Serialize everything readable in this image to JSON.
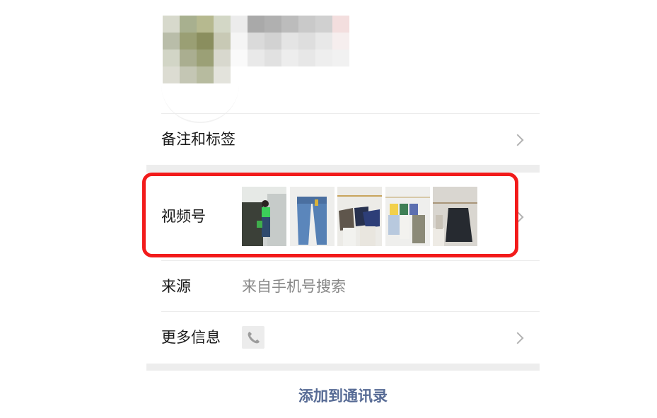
{
  "rows": {
    "remarks_tags": {
      "label": "备注和标签"
    },
    "channels": {
      "label": "视频号"
    },
    "source": {
      "label": "来源",
      "value": "来自手机号搜索"
    },
    "more_info": {
      "label": "更多信息"
    }
  },
  "action": {
    "add_to_contacts": "添加到通讯录"
  },
  "icons": {
    "chevron": "chevron-right-icon",
    "phone": "phone-icon"
  },
  "colors": {
    "highlight_border": "#f21b1b",
    "link_blue": "#576b95",
    "section_gap": "#ededed"
  }
}
